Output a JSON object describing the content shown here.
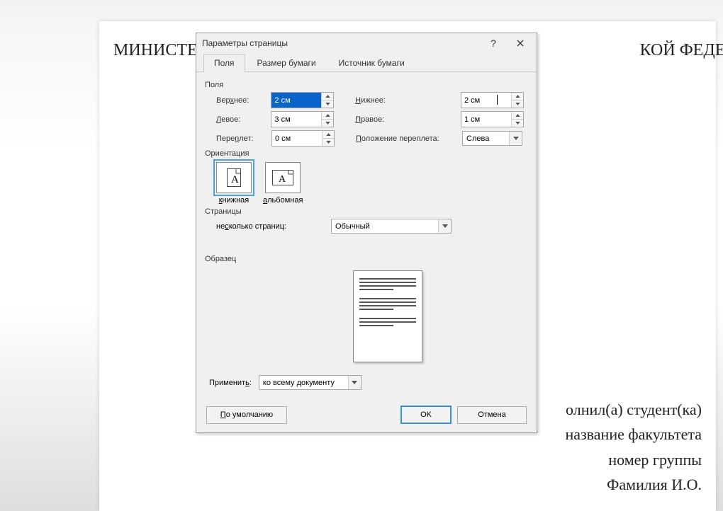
{
  "document": {
    "title_visible": "МИНИСТЕ__________________________________КОЙ ФЕДЕРАЦИИ",
    "title_left": "МИНИСТЕ",
    "title_right": "КОЙ ФЕДЕРАЦИИ",
    "lines": [
      "олнил(а) студент(ка)",
      "название факультета",
      "номер группы",
      "Фамилия И.О."
    ]
  },
  "dialog": {
    "title": "Параметры страницы",
    "help": "?",
    "tabs": {
      "fields": "Поля",
      "paper_size": "Размер бумаги",
      "paper_source": "Источник бумаги",
      "active": "fields"
    },
    "margins": {
      "group": "Поля",
      "top_label": "Верхнее:",
      "top_value": "2 см",
      "bottom_label": "Нижнее:",
      "bottom_value": "2 см",
      "left_label": "Левое:",
      "left_value": "3 см",
      "right_label": "Правое:",
      "right_value": "1 см",
      "gutter_label": "Переплет:",
      "gutter_value": "0 см",
      "gutter_pos_label": "Положение переплета:",
      "gutter_pos_value": "Слева"
    },
    "orientation": {
      "group": "Ориентация",
      "portrait": "книжная",
      "landscape": "альбомная",
      "selected": "portrait"
    },
    "pages": {
      "group": "Страницы",
      "multi_label": "несколько страниц:",
      "multi_value": "Обычный"
    },
    "sample": {
      "group": "Образец"
    },
    "apply": {
      "label": "Применить:",
      "value": "ко всему документу"
    },
    "footer": {
      "default": "По умолчанию",
      "ok": "OK",
      "cancel": "Отмена"
    }
  }
}
